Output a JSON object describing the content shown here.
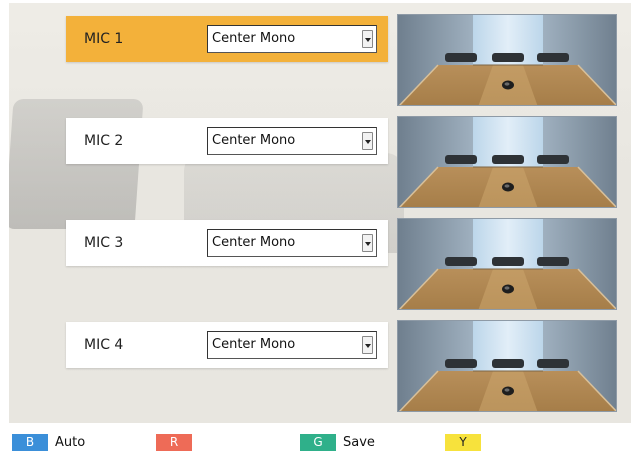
{
  "mics": [
    {
      "label": "MIC 1",
      "mode": "Center Mono",
      "active": true
    },
    {
      "label": "MIC 2",
      "mode": "Center Mono",
      "active": false
    },
    {
      "label": "MIC 3",
      "mode": "Center Mono",
      "active": false
    },
    {
      "label": "MIC 4",
      "mode": "Center Mono",
      "active": false
    }
  ],
  "footer": {
    "b_key": "B",
    "b_label": "Auto",
    "r_key": "R",
    "r_label": "",
    "g_key": "G",
    "g_label": "Save",
    "y_key": "Y",
    "y_label": ""
  },
  "colors": {
    "active_row": "#f3b13a",
    "key_blue": "#3b8fd9",
    "key_red": "#ee6b57",
    "key_green": "#2fb08a",
    "key_yellow": "#f7e23c"
  }
}
